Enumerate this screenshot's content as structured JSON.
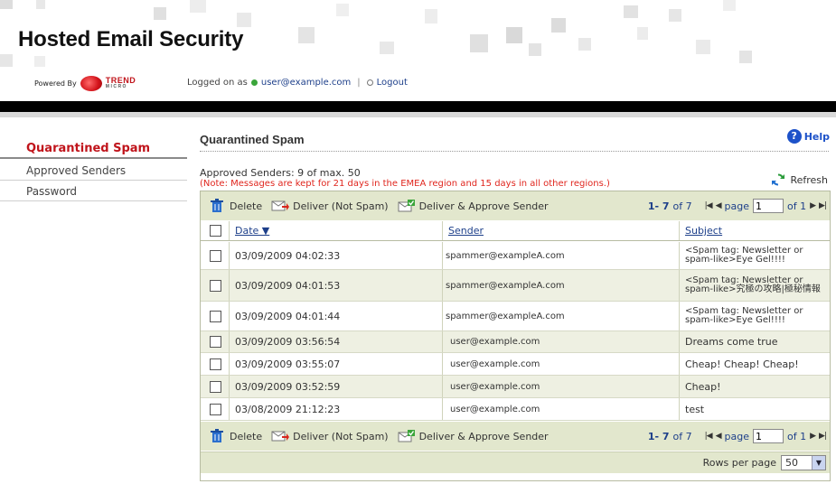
{
  "app": {
    "title": "Hosted Email Security",
    "powered_by": "Powered By",
    "brand_name": "TREND",
    "brand_sub": "MICRO",
    "logged_on_label": "Logged on as",
    "user": "user@example.com",
    "separator": "|",
    "logout": "Logout",
    "colors": {
      "accent_red": "#c0141b",
      "link_blue": "#1d3f8a",
      "toolbar_green": "#e2e7cd",
      "alt_row": "#eef0e2"
    }
  },
  "sidebar": {
    "items": [
      {
        "label": "Quarantined Spam",
        "active": true
      },
      {
        "label": "Approved Senders",
        "active": false
      },
      {
        "label": "Password",
        "active": false
      }
    ]
  },
  "main": {
    "title": "Quarantined Spam",
    "help": "Help",
    "approved_info": "Approved Senders: 9 of max. 50",
    "note": "(Note: Messages are kept for 21 days in the EMEA region and 15 days in all other regions.)",
    "refresh": "Refresh"
  },
  "toolbar": {
    "delete": "Delete",
    "deliver": "Deliver (Not Spam)",
    "deliver_approve": "Deliver & Approve Sender",
    "range": "1- 7",
    "of_total": "of 7",
    "page_label": "page",
    "page_value": "1",
    "of_pages": "of 1"
  },
  "table": {
    "columns": {
      "date": "Date ▼",
      "sender": "Sender",
      "subject": "Subject"
    },
    "rows": [
      {
        "date": "03/09/2009 04:02:33",
        "sender": "spammer@exampleA.com",
        "subject": "<Spam tag: Newsletter or spam-like>Eye Gel!!!!"
      },
      {
        "date": "03/09/2009 04:01:53",
        "sender": "spammer@exampleA.com",
        "subject": "<Spam tag: Newsletter or spam-like>究極の攻略|極秘情報"
      },
      {
        "date": "03/09/2009 04:01:44",
        "sender": "spammer@exampleA.com",
        "subject": "<Spam tag: Newsletter or spam-like>Eye Gel!!!!"
      },
      {
        "date": "03/09/2009 03:56:54",
        "sender": "user@example.com",
        "subject": "Dreams come true"
      },
      {
        "date": "03/09/2009 03:55:07",
        "sender": "user@example.com",
        "subject": "Cheap! Cheap! Cheap!"
      },
      {
        "date": "03/09/2009 03:52:59",
        "sender": "user@example.com",
        "subject": "Cheap!"
      },
      {
        "date": "03/08/2009 21:12:23",
        "sender": "user@example.com",
        "subject": "test"
      }
    ]
  },
  "footer": {
    "rows_per_page_label": "Rows per page",
    "rows_per_page_value": "50"
  }
}
